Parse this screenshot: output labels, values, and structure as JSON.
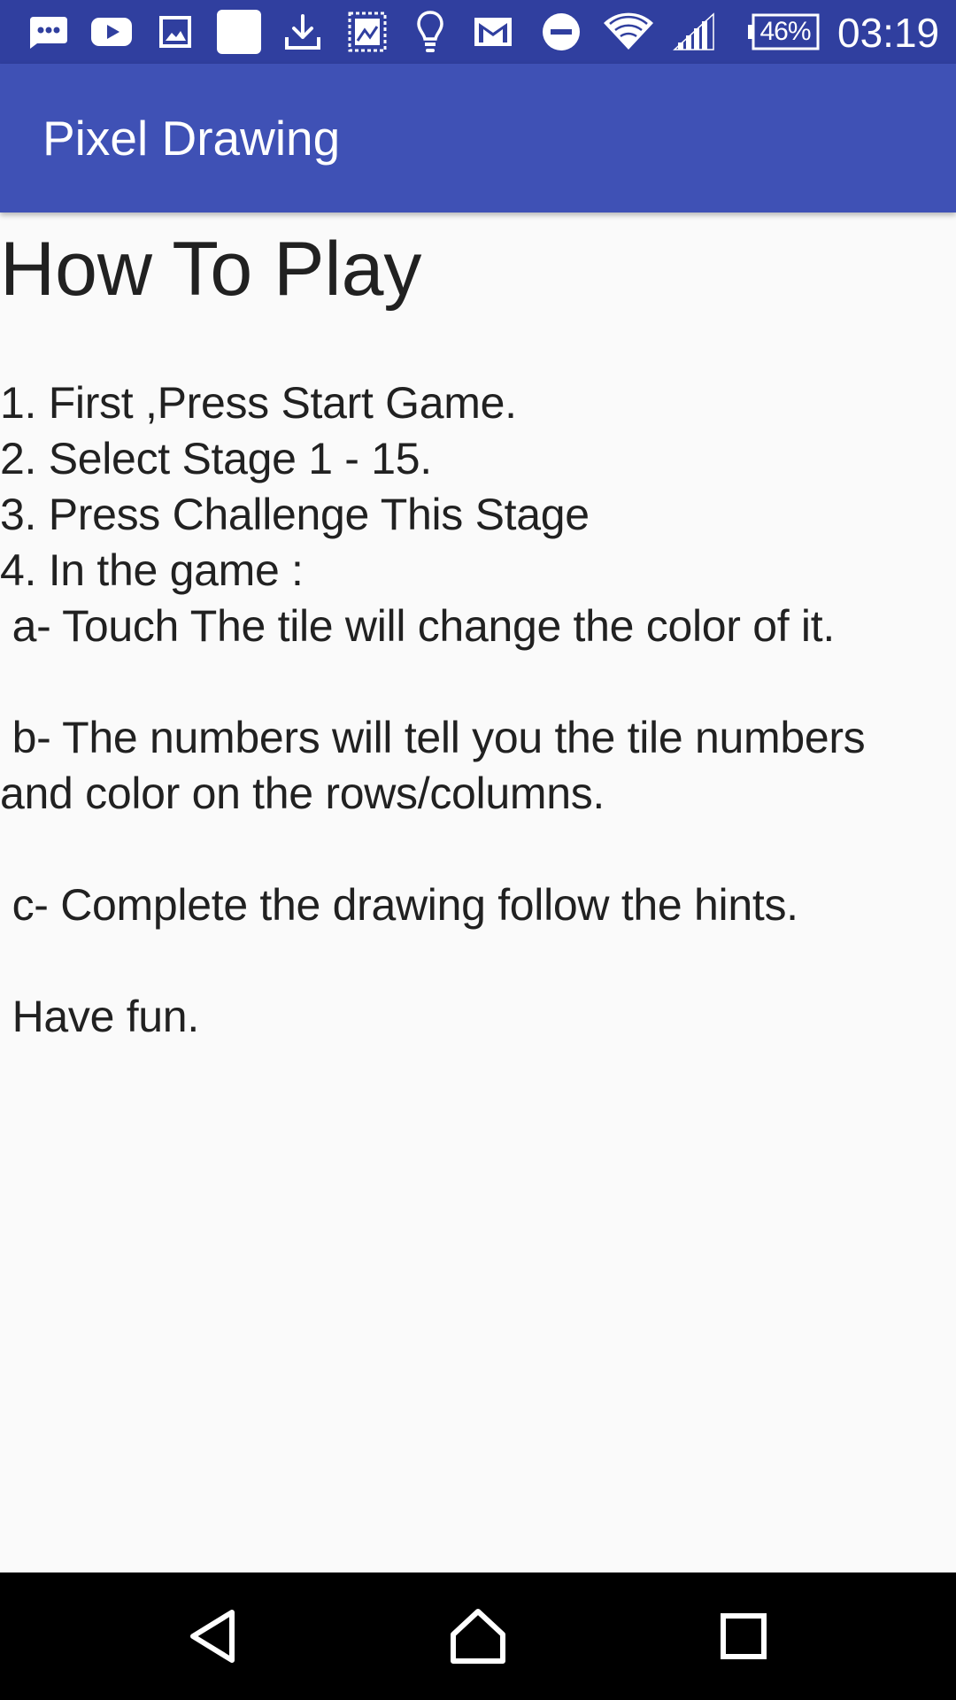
{
  "status_bar": {
    "icons": [
      "chat-bubble-icon",
      "youtube-icon",
      "image-icon",
      "blank-square-icon",
      "download-icon",
      "stamp-icon",
      "lightbulb-icon",
      "gmail-icon",
      "do-not-disturb-icon",
      "wifi-icon",
      "cell-signal-icon"
    ],
    "battery_percent": "46%",
    "time": "03:19",
    "background_color": "#303f9f"
  },
  "app_bar": {
    "title": "Pixel Drawing",
    "background_color": "#3f51b5"
  },
  "content": {
    "heading": "How To Play",
    "lines": [
      "1. First ,Press Start Game.",
      "2. Select Stage 1 - 15.",
      "3. Press Challenge This Stage",
      "4. In the game :",
      " a- Touch The tile will change the color of it.",
      "",
      " b- The numbers will tell you the tile numbers",
      "and color on the rows/columns.",
      "",
      " c- Complete the drawing follow the hints.",
      "",
      " Have fun."
    ]
  },
  "nav_bar": {
    "buttons": [
      "back-icon",
      "home-icon",
      "recents-icon"
    ]
  }
}
